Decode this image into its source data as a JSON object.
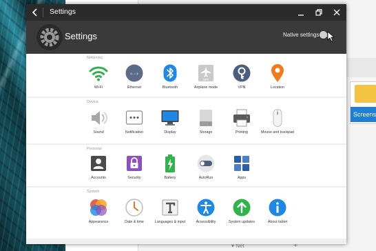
{
  "window": {
    "title": "Settings",
    "header_title": "Settings",
    "native_settings_label": "Native settings"
  },
  "background": {
    "folder_label": "Screensh",
    "bottom_label": "Net",
    "bottom_plus": "+"
  },
  "sections": [
    {
      "label": "Networks",
      "items": [
        {
          "label": "Wi-Fi",
          "icon": "wifi-icon",
          "color": "#2fb34a"
        },
        {
          "label": "Ethernet",
          "icon": "ethernet-icon",
          "color": "#5c6b8a"
        },
        {
          "label": "Bluetooth",
          "icon": "bluetooth-icon",
          "color": "#1e88e5"
        },
        {
          "label": "Airplane mode",
          "icon": "airplane-icon",
          "color": "#b8b8b8"
        },
        {
          "label": "VPN",
          "icon": "vpn-icon",
          "color": "#4a5f80"
        },
        {
          "label": "Location",
          "icon": "location-icon",
          "color": "#f27a1a"
        }
      ]
    },
    {
      "label": "Device",
      "items": [
        {
          "label": "Sound",
          "icon": "speaker-icon",
          "color": "#9e9e9e"
        },
        {
          "label": "Notification",
          "icon": "notification-icon",
          "color": "#555555"
        },
        {
          "label": "Display",
          "icon": "display-icon",
          "color": "#1e88e5"
        },
        {
          "label": "Storage",
          "icon": "storage-icon",
          "color": "#9e9e9e"
        },
        {
          "label": "Printing",
          "icon": "printer-icon",
          "color": "#666666"
        },
        {
          "label": "Mouse and trackpad",
          "icon": "mouse-icon",
          "color": "#dddddd"
        }
      ]
    },
    {
      "label": "Personal",
      "items": [
        {
          "label": "Accounts",
          "icon": "account-icon",
          "color": "#4a4a4a"
        },
        {
          "label": "Security",
          "icon": "security-lock-icon",
          "color": "#8e4fbf"
        },
        {
          "label": "Battery",
          "icon": "battery-icon",
          "color": "#2fb34a"
        },
        {
          "label": "AutoRun",
          "icon": "autorun-toggle-icon",
          "color": "#4a5f80"
        },
        {
          "label": "Apps",
          "icon": "apps-grid-icon",
          "color": "#2a5fa8"
        }
      ]
    },
    {
      "label": "System",
      "items": [
        {
          "label": "Appearance",
          "icon": "appearance-icon",
          "color": "#e94e3c"
        },
        {
          "label": "Date & time",
          "icon": "clock-icon",
          "color": "#e8742a"
        },
        {
          "label": "Languages & input",
          "icon": "language-icon",
          "color": "#555555"
        },
        {
          "label": "Accessibility",
          "icon": "accessibility-icon",
          "color": "#1e88e5"
        },
        {
          "label": "System updates",
          "icon": "system-update-icon",
          "color": "#2fb34a"
        },
        {
          "label": "About tablet",
          "icon": "info-icon",
          "color": "#1e88e5"
        }
      ]
    }
  ]
}
